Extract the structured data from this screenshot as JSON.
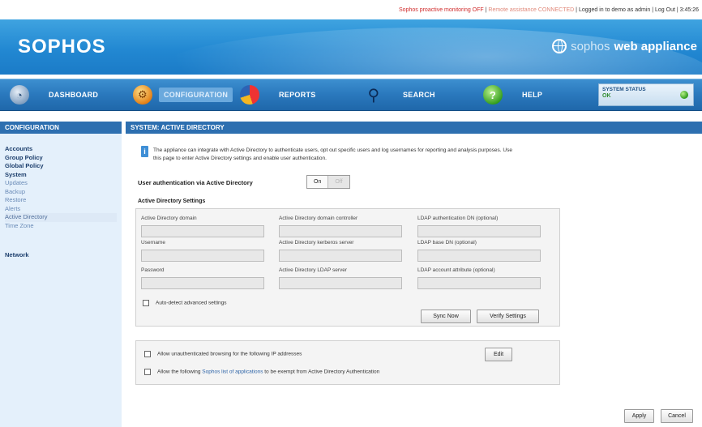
{
  "topbar": {
    "monitoring": "Sophos proactive monitoring OFF",
    "sep1": " | ",
    "remote": "Remote assistance CONNECTED",
    "sep2": " | ",
    "login": "Logged in to demo as admin",
    "sep3": " | ",
    "logout": "Log Out",
    "sep4": " | ",
    "time": "3:45:26"
  },
  "header": {
    "logo": "SOPHOS",
    "product_prefix": "sophos",
    "product_name": "web appliance"
  },
  "nav": {
    "items": [
      {
        "label": "DASHBOARD",
        "icon": "dashboard-gauge-icon"
      },
      {
        "label": "CONFIGURATION",
        "icon": "gears-icon"
      },
      {
        "label": "REPORTS",
        "icon": "pie-chart-icon"
      },
      {
        "label": "SEARCH",
        "icon": "magnifier-icon"
      },
      {
        "label": "HELP",
        "icon": "question-icon"
      }
    ],
    "status_title": "SYSTEM STATUS",
    "status_value": "OK"
  },
  "sidebar": {
    "heading": "CONFIGURATION",
    "groups": [
      "Accounts",
      "Group Policy",
      "Global Policy",
      "System"
    ],
    "system_items": [
      "Updates",
      "Backup",
      "Restore",
      "Alerts",
      "Active Directory",
      "Time Zone"
    ],
    "network": "Network"
  },
  "main": {
    "heading": "SYSTEM: ACTIVE DIRECTORY",
    "info_line1": "The appliance can integrate with Active Directory to authenticate users, opt out specific users and log usernames for reporting and analysis purposes. Use",
    "info_line2": "this page to enter Active Directory settings and enable user authentication.",
    "auth_label": "User authentication via Active Directory",
    "toggle_on": "On",
    "toggle_off": "Off",
    "settings_title": "Active Directory Settings",
    "fields": {
      "ad_domain": "Active Directory domain",
      "ad_controller": "Active Directory domain controller",
      "ldap_auth_dn": "LDAP authentication DN (optional)",
      "username": "Username",
      "kerberos": "Active Directory kerberos server",
      "ldap_base_dn": "LDAP base DN (optional)",
      "password": "Password",
      "ldap_server": "Active Directory LDAP server",
      "ldap_attr": "LDAP account attribute (optional)"
    },
    "autodetect": "Auto-detect advanced settings",
    "sync_now": "Sync Now",
    "verify": "Verify Settings",
    "allow_unauth": "Allow unauthenticated browsing for the following IP addresses",
    "edit": "Edit",
    "exempt_prefix": "Allow the following ",
    "exempt_link": "Sophos list of applications",
    "exempt_suffix": " to be exempt from Active Directory Authentication",
    "apply": "Apply",
    "cancel": "Cancel"
  },
  "colors": {
    "header_blue": "#2288d2",
    "nav_blue": "#2a78bd",
    "section_bar": "#2d6fb0",
    "sidebar_bg": "#e4f0fb",
    "status_ok": "#2e8b2e"
  }
}
